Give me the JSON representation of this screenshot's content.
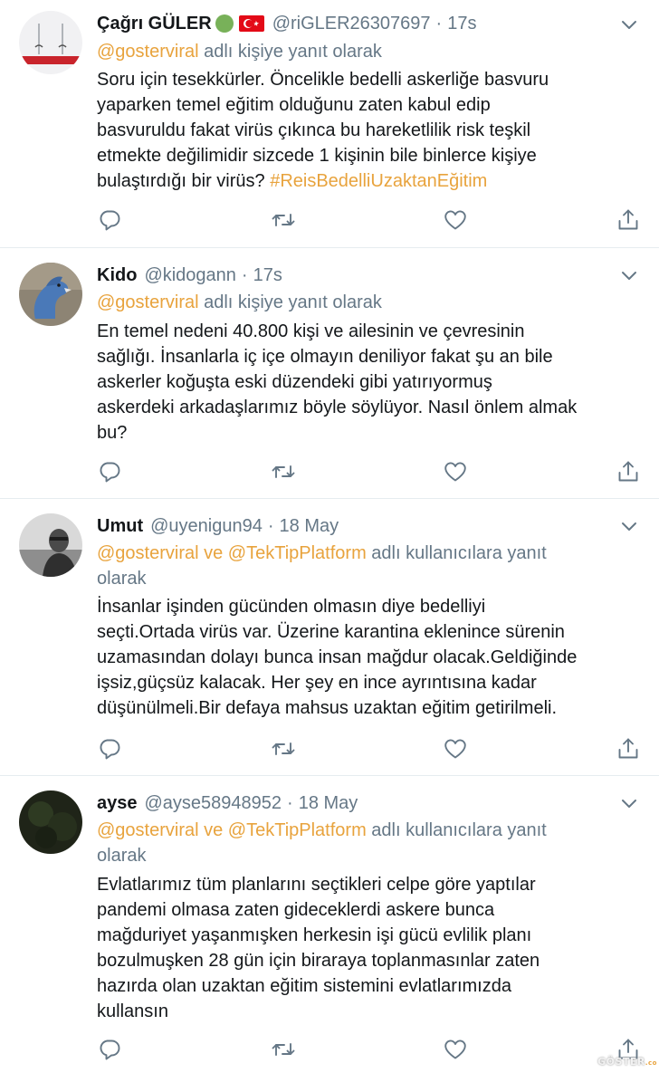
{
  "tweets": [
    {
      "name": "Çağrı GÜLER",
      "flags": [
        "green-circle",
        "turkey-flag"
      ],
      "handle": "@riGLER26307697",
      "time": "17s",
      "reply_mentions": "@gosterviral",
      "reply_suffix": " adlı kişiye yanıt olarak",
      "text": "Soru için tesekkürler. Öncelikle bedelli askerliğe basvuru\nyaparken temel eğitim olduğunu zaten kabul edip\nbasvuruldu fakat virüs çıkınca bu hareketlilik risk teşkil\netmekte değilimidir sizcede 1 kişinin bile binlerce kişiye\nbulaştırdığı bir virüs?  ",
      "hashtag": "#ReisBedelliUzaktanEğitim"
    },
    {
      "name": "Kido",
      "handle": "@kidogann",
      "time": "17s",
      "reply_mentions": "@gosterviral",
      "reply_suffix": " adlı kişiye yanıt olarak",
      "text": "En temel nedeni 40.800 kişi ve ailesinin ve çevresinin\nsağlığı. İnsanlarla iç içe olmayın deniliyor fakat şu an bile\naskerler koğuşta eski düzendeki gibi yatırıyormuş\naskerdeki arkadaşlarımız böyle söylüyor. Nasıl önlem almak\nbu?"
    },
    {
      "name": "Umut",
      "handle": "@uyenigun94",
      "time": "18 May",
      "reply_mentions": "@gosterviral ve @TekTipPlatform",
      "reply_suffix": " adlı kullanıcılara yanıt\nolarak",
      "text": "İnsanlar işinden gücünden olmasın diye bedelliyi\nseçti.Ortada virüs var. Üzerine karantina eklenince sürenin\nuzamasından dolayı bunca insan mağdur olacak.Geldiğinde\nişsiz,güçsüz kalacak. Her şey en ince ayrıntısına kadar\ndüşünülmeli.Bir defaya mahsus uzaktan eğitim getirilmeli."
    },
    {
      "name": "ayse",
      "handle": "@ayse58948952",
      "time": "18 May",
      "reply_mentions": "@gosterviral ve @TekTipPlatform",
      "reply_suffix": " adlı kullanıcılara yanıt\nolarak",
      "text": "Evlatlarımız tüm planlarını seçtikleri celpe göre yaptılar\npandemi olmasa zaten gideceklerdi askere bunca\nmağduriyet yaşanmışken herkesin işi gücü evlilik planı\nbozulmuşken 28 gün için biraraya toplanmasınlar  zaten\nhazırda olan uzaktan eğitim sistemini evlatlarımızda\nkullansın"
    }
  ],
  "ui": {
    "dot": "·",
    "icons": {
      "reply": "reply-icon",
      "retweet": "retweet-icon",
      "like": "heart-icon",
      "share": "share-icon",
      "menu": "chevron-down-icon"
    },
    "colors": {
      "mention": "#e8a33d",
      "secondary_text": "#657786",
      "icon": "#657786",
      "divider": "#e6ecf0"
    }
  },
  "watermark": {
    "text": "GÖSTER",
    "suffix": ".co"
  }
}
